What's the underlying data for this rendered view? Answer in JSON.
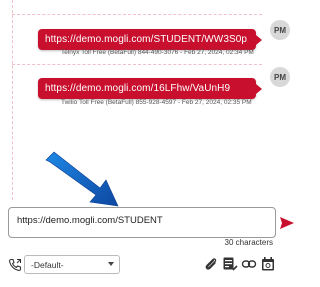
{
  "messages": [
    {
      "text": "https://demo.mogli.com/STUDENT/WW3S0p",
      "avatar": "PM",
      "meta": "Telnyx Toll Free (BetaFull) 844-490-3076 - Feb 27, 2024, 02:34 PM"
    },
    {
      "text": "https://demo.mogli.com/16LFhw/VaUnH9",
      "avatar": "PM",
      "meta": "Twilio Toll Free (BetaFull) 855-928-4597 - Feb 27, 2024, 02:35 PM"
    }
  ],
  "composer": {
    "value": "https://demo.mogli.com/STUDENT",
    "char_count": "30 characters"
  },
  "sender_select": {
    "value": "-Default-"
  },
  "icons": {
    "send": "send-icon",
    "phone": "phone-icon",
    "attach": "paperclip-icon",
    "template": "template-icon",
    "link": "link-icon",
    "schedule": "calendar-icon",
    "annotation": "arrow-icon"
  },
  "colors": {
    "bubble": "#c8102e",
    "annotation_arrow": "#1565c0",
    "send": "#c8102e"
  }
}
